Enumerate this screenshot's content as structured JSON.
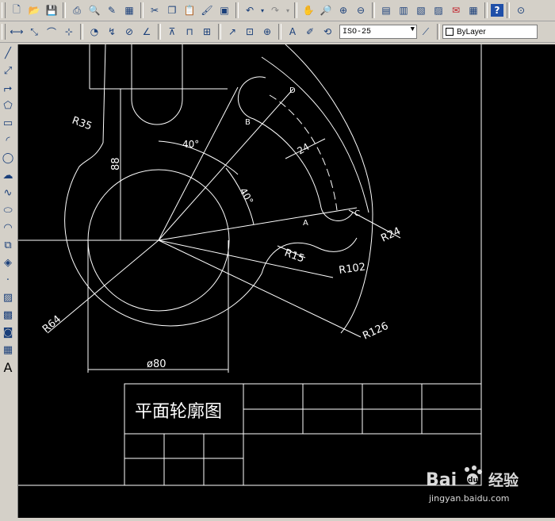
{
  "toolbar_top": {
    "buttons": [
      "new-icon",
      "open-icon",
      "save-icon",
      "print-icon",
      "preview-icon",
      "publish-icon",
      "plot-icon",
      "cut-icon",
      "copy-icon",
      "paste-icon",
      "matchprop-icon",
      "blockeditor-icon",
      "undo-icon",
      "redo-icon",
      "pan-icon",
      "zoom-realtime-icon",
      "zoom-window-icon",
      "zoom-previous-icon",
      "properties-icon",
      "designcenter-icon",
      "toolpalettes-icon",
      "sheetset-icon",
      "markup-icon",
      "calculator-icon",
      "help-icon",
      "extra-icon"
    ]
  },
  "toolbar_dim": {
    "dimstyle_value": "ISO-25",
    "layer_value": "ByLayer"
  },
  "drawing": {
    "title_block_text": "平面轮廓图",
    "labels": {
      "r35": "R35",
      "r64": "R64",
      "r15": "R15",
      "r102": "R102",
      "r126": "R126",
      "r24": "R24",
      "d80": "ø80",
      "d88": "88",
      "a40_1": "40°",
      "a40_2": "40°",
      "d24": "24",
      "pA": "A",
      "pB": "B",
      "pC": "C",
      "pD": "D"
    }
  },
  "watermark": {
    "brand": "Bai",
    "brand2": "du",
    "product": "经验",
    "url": "jingyan.baidu.com"
  }
}
